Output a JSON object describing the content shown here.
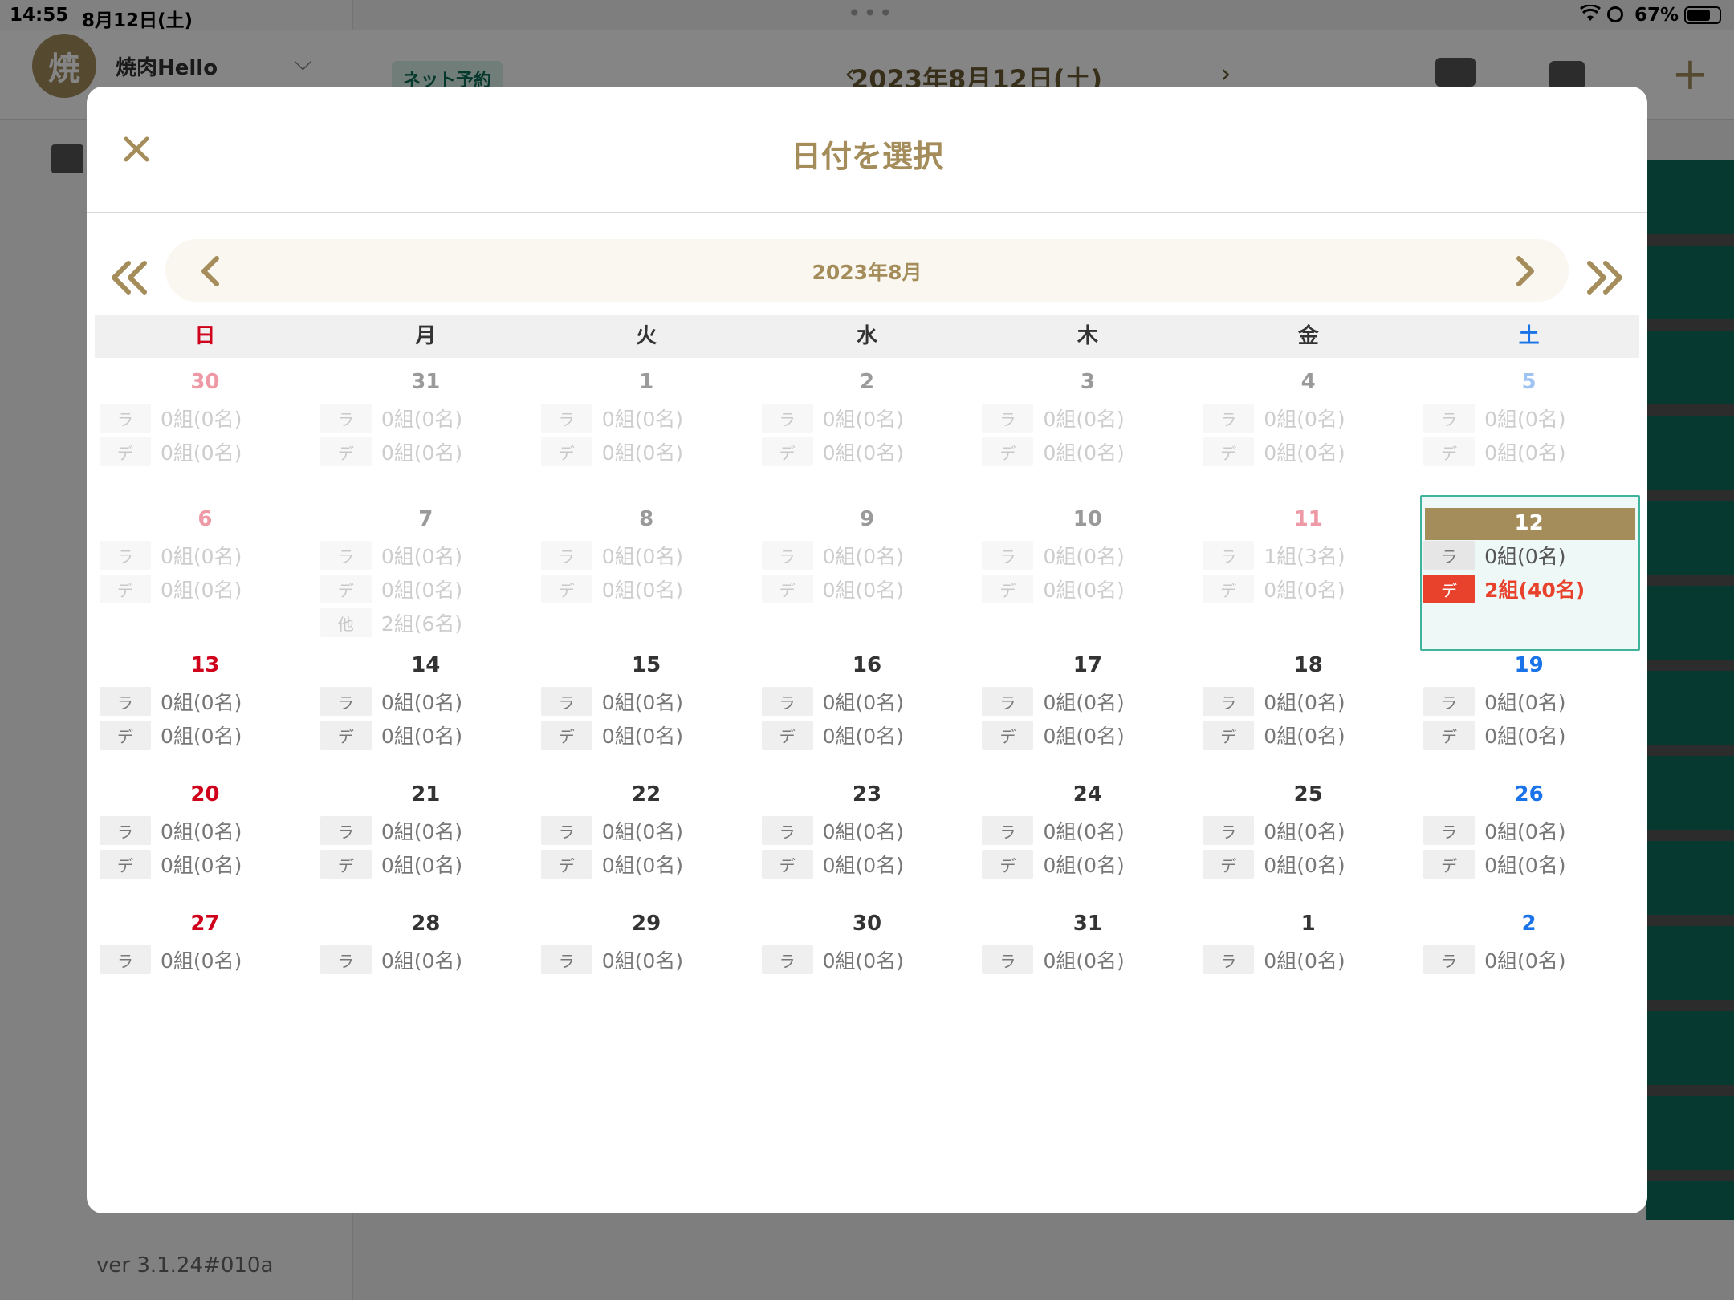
{
  "status_bar": {
    "time": "14:55",
    "date": "8月12日(土)",
    "dots": "•••",
    "battery": "67%"
  },
  "background": {
    "shop_avatar": "焼",
    "shop_name": "焼肉Hello",
    "net_badge": "ネット予約",
    "header_date": "2023年8月12日(土)",
    "version": "ver 3.1.24#010a"
  },
  "modal": {
    "title": "日付を選択",
    "month_label": "2023年8月",
    "weekdays": [
      "日",
      "月",
      "火",
      "水",
      "木",
      "金",
      "土"
    ],
    "accent_color": "#a48d5a",
    "alert_color": "#e8412c",
    "weeks": [
      [
        {
          "day": "30",
          "muted": true,
          "rows": [
            [
              "ラ",
              "0組(0名)"
            ],
            [
              "デ",
              "0組(0名)"
            ]
          ]
        },
        {
          "day": "31",
          "muted": true,
          "rows": [
            [
              "ラ",
              "0組(0名)"
            ],
            [
              "デ",
              "0組(0名)"
            ]
          ]
        },
        {
          "day": "1",
          "muted": true,
          "rows": [
            [
              "ラ",
              "0組(0名)"
            ],
            [
              "デ",
              "0組(0名)"
            ]
          ]
        },
        {
          "day": "2",
          "muted": true,
          "rows": [
            [
              "ラ",
              "0組(0名)"
            ],
            [
              "デ",
              "0組(0名)"
            ]
          ]
        },
        {
          "day": "3",
          "muted": true,
          "rows": [
            [
              "ラ",
              "0組(0名)"
            ],
            [
              "デ",
              "0組(0名)"
            ]
          ]
        },
        {
          "day": "4",
          "muted": true,
          "rows": [
            [
              "ラ",
              "0組(0名)"
            ],
            [
              "デ",
              "0組(0名)"
            ]
          ]
        },
        {
          "day": "5",
          "muted": true,
          "rows": [
            [
              "ラ",
              "0組(0名)"
            ],
            [
              "デ",
              "0組(0名)"
            ]
          ]
        }
      ],
      [
        {
          "day": "6",
          "muted": true,
          "rows": [
            [
              "ラ",
              "0組(0名)"
            ],
            [
              "デ",
              "0組(0名)"
            ]
          ]
        },
        {
          "day": "7",
          "muted": true,
          "rows": [
            [
              "ラ",
              "0組(0名)"
            ],
            [
              "デ",
              "0組(0名)"
            ],
            [
              "他",
              "2組(6名)"
            ]
          ]
        },
        {
          "day": "8",
          "muted": true,
          "rows": [
            [
              "ラ",
              "0組(0名)"
            ],
            [
              "デ",
              "0組(0名)"
            ]
          ]
        },
        {
          "day": "9",
          "muted": true,
          "rows": [
            [
              "ラ",
              "0組(0名)"
            ],
            [
              "デ",
              "0組(0名)"
            ]
          ]
        },
        {
          "day": "10",
          "muted": true,
          "rows": [
            [
              "ラ",
              "0組(0名)"
            ],
            [
              "デ",
              "0組(0名)"
            ]
          ]
        },
        {
          "day": "11",
          "muted": true,
          "holiday": true,
          "rows": [
            [
              "ラ",
              "1組(3名)"
            ],
            [
              "デ",
              "0組(0名)"
            ]
          ]
        },
        {
          "day": "12",
          "selected": true,
          "rows": [
            [
              "ラ",
              "0組(0名)"
            ],
            [
              "デ",
              "2組(40名)",
              "alert"
            ]
          ]
        }
      ],
      [
        {
          "day": "13",
          "rows": [
            [
              "ラ",
              "0組(0名)"
            ],
            [
              "デ",
              "0組(0名)"
            ]
          ]
        },
        {
          "day": "14",
          "rows": [
            [
              "ラ",
              "0組(0名)"
            ],
            [
              "デ",
              "0組(0名)"
            ]
          ]
        },
        {
          "day": "15",
          "rows": [
            [
              "ラ",
              "0組(0名)"
            ],
            [
              "デ",
              "0組(0名)"
            ]
          ]
        },
        {
          "day": "16",
          "rows": [
            [
              "ラ",
              "0組(0名)"
            ],
            [
              "デ",
              "0組(0名)"
            ]
          ]
        },
        {
          "day": "17",
          "rows": [
            [
              "ラ",
              "0組(0名)"
            ],
            [
              "デ",
              "0組(0名)"
            ]
          ]
        },
        {
          "day": "18",
          "rows": [
            [
              "ラ",
              "0組(0名)"
            ],
            [
              "デ",
              "0組(0名)"
            ]
          ]
        },
        {
          "day": "19",
          "rows": [
            [
              "ラ",
              "0組(0名)"
            ],
            [
              "デ",
              "0組(0名)"
            ]
          ]
        }
      ],
      [
        {
          "day": "20",
          "rows": [
            [
              "ラ",
              "0組(0名)"
            ],
            [
              "デ",
              "0組(0名)"
            ]
          ]
        },
        {
          "day": "21",
          "rows": [
            [
              "ラ",
              "0組(0名)"
            ],
            [
              "デ",
              "0組(0名)"
            ]
          ]
        },
        {
          "day": "22",
          "rows": [
            [
              "ラ",
              "0組(0名)"
            ],
            [
              "デ",
              "0組(0名)"
            ]
          ]
        },
        {
          "day": "23",
          "rows": [
            [
              "ラ",
              "0組(0名)"
            ],
            [
              "デ",
              "0組(0名)"
            ]
          ]
        },
        {
          "day": "24",
          "rows": [
            [
              "ラ",
              "0組(0名)"
            ],
            [
              "デ",
              "0組(0名)"
            ]
          ]
        },
        {
          "day": "25",
          "rows": [
            [
              "ラ",
              "0組(0名)"
            ],
            [
              "デ",
              "0組(0名)"
            ]
          ]
        },
        {
          "day": "26",
          "rows": [
            [
              "ラ",
              "0組(0名)"
            ],
            [
              "デ",
              "0組(0名)"
            ]
          ]
        }
      ],
      [
        {
          "day": "27",
          "rows": [
            [
              "ラ",
              "0組(0名)"
            ]
          ]
        },
        {
          "day": "28",
          "rows": [
            [
              "ラ",
              "0組(0名)"
            ]
          ]
        },
        {
          "day": "29",
          "rows": [
            [
              "ラ",
              "0組(0名)"
            ]
          ]
        },
        {
          "day": "30",
          "rows": [
            [
              "ラ",
              "0組(0名)"
            ]
          ]
        },
        {
          "day": "31",
          "rows": [
            [
              "ラ",
              "0組(0名)"
            ]
          ]
        },
        {
          "day": "1",
          "rows": [
            [
              "ラ",
              "0組(0名)"
            ]
          ]
        },
        {
          "day": "2",
          "rows": [
            [
              "ラ",
              "0組(0名)"
            ]
          ]
        }
      ]
    ]
  }
}
